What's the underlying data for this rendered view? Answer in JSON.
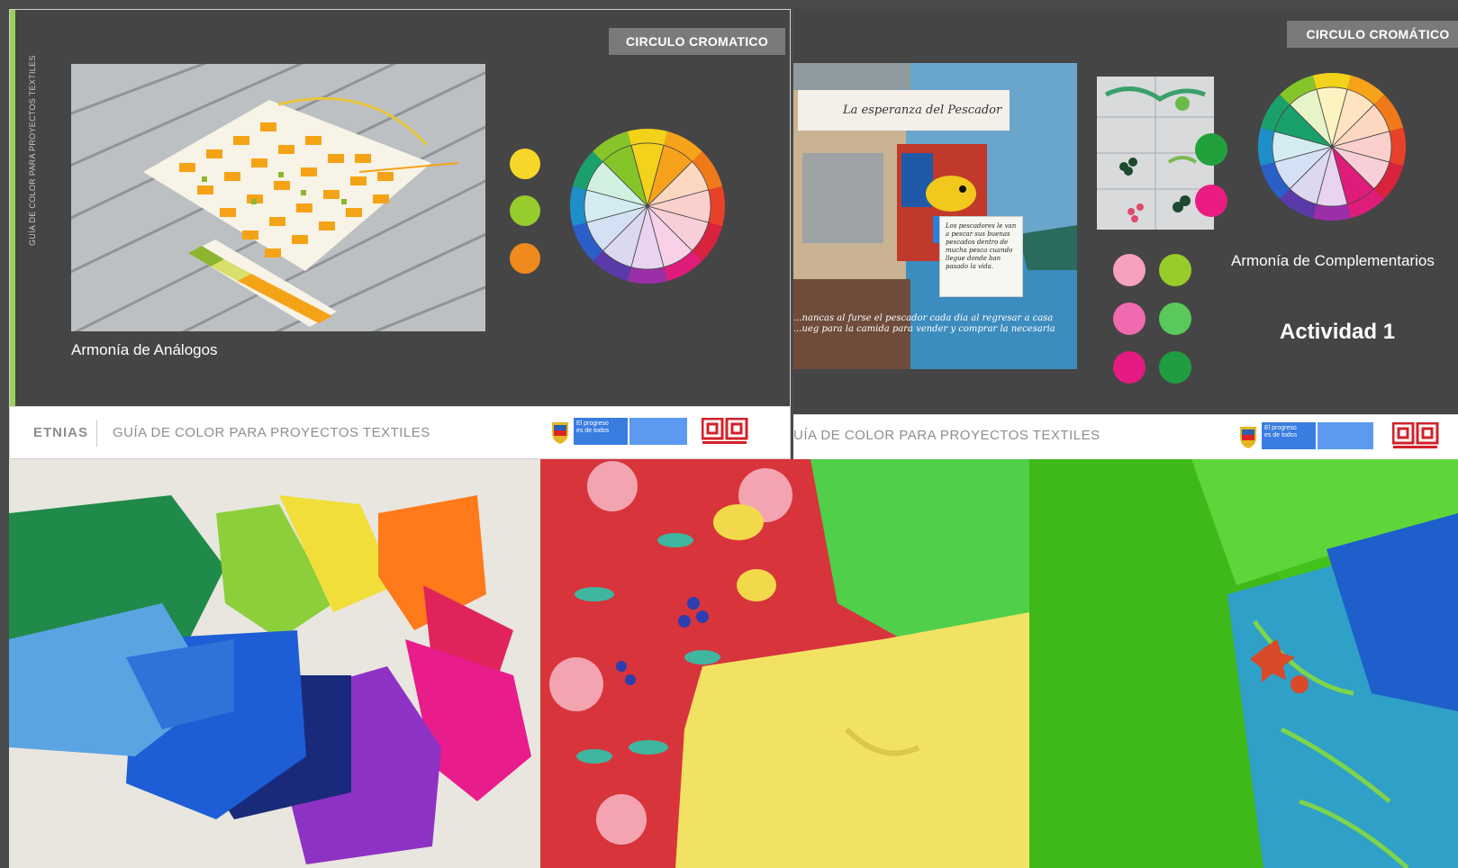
{
  "slide1": {
    "side_label": "GUÍA DE COLOR PARA PROYECTOS TEXTILES",
    "badge": "CIRCULO CROMATICO",
    "caption": "Armonía de Análogos",
    "swatches": [
      "#f7d62a",
      "#96cc2c",
      "#f08a1c"
    ],
    "footer": {
      "etnias": "ETNIAS",
      "guide": "GUÍA DE COLOR PARA PROYECTOS TEXTILES",
      "gov_line1": "El progreso",
      "gov_line2": "es de todos"
    }
  },
  "slide2": {
    "badge": "CIRCULO CROMÁTICO",
    "caption": "Armonía de Complementarios",
    "activity": "Actividad 1",
    "poster_title": "La esperanza del Pescador",
    "poster_note": "Los pescadores le van a pescar sus buenas pescados dentro de mucha pesca cuando llegue donde ban pasado la vida.",
    "poster_caption": "...nancas al furse el pescador cada dia al regresar a casa ...ueg para la camida para vender y comprar la necesaria",
    "footer": {
      "guide": "UÍA DE COLOR PARA PROYECTOS TEXTILES",
      "gov_line1": "El progreso",
      "gov_line2": "es de todos"
    },
    "swatch_pair": [
      "#21a03c",
      "#ea1c83"
    ],
    "grid_swatches": [
      [
        "#f7a1bd",
        "#98cc2a"
      ],
      [
        "#f06ab0",
        "#5ac85a"
      ],
      [
        "#e51a82",
        "#1f9d40"
      ]
    ]
  },
  "colors": {
    "slide_bg": "#454545",
    "badge_bg": "#7a7a7a",
    "gov_blue": "#3a7de0",
    "logo_red": "#d3202a"
  },
  "bottom_photos": [
    "fabric-color-wheel-photo",
    "floral-fabric-photo",
    "green-fabric-photo"
  ]
}
